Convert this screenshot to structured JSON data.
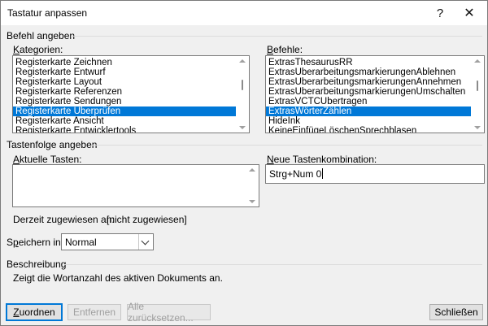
{
  "window": {
    "title": "Tastatur anpassen",
    "help_glyph": "?",
    "close_glyph": "✕"
  },
  "befehl": {
    "section_label": "Befehl angeben",
    "kategorien": {
      "label": "Kategorien:",
      "items": [
        {
          "label": "Registerkarte Zeichnen",
          "selected": false
        },
        {
          "label": "Registerkarte Entwurf",
          "selected": false
        },
        {
          "label": "Registerkarte Layout",
          "selected": false
        },
        {
          "label": "Registerkarte Referenzen",
          "selected": false
        },
        {
          "label": "Registerkarte Sendungen",
          "selected": false
        },
        {
          "label": "Registerkarte Überprüfen",
          "selected": true
        },
        {
          "label": "Registerkarte Ansicht",
          "selected": false
        },
        {
          "label": "Registerkarte Entwicklertools",
          "selected": false
        }
      ]
    },
    "befehle": {
      "label": "Befehle:",
      "items": [
        {
          "label": "ExtrasThesaurusRR",
          "selected": false
        },
        {
          "label": "ExtrasÜberarbeitungsmarkierungenAblehnen",
          "selected": false
        },
        {
          "label": "ExtrasÜberarbeitungsmarkierungenAnnehmen",
          "selected": false
        },
        {
          "label": "ExtrasÜberarbeitungsmarkierungenUmschalten",
          "selected": false
        },
        {
          "label": "ExtrasVCTCÜbertragen",
          "selected": false
        },
        {
          "label": "ExtrasWörterZählen",
          "selected": true
        },
        {
          "label": "HideInk",
          "selected": false
        },
        {
          "label": "KeineEinfügeLöschenSprechblasen",
          "selected": false
        }
      ]
    }
  },
  "tastenfolge": {
    "section_label": "Tastenfolge angeben",
    "aktuelle_label": "Aktuelle Tasten:",
    "neue_label": "Neue Tastenkombination:",
    "neue_value": "Strg+Num 0",
    "zugewiesen_label": "Derzeit zugewiesen an:",
    "zugewiesen_value": "[nicht zugewiesen]"
  },
  "speichern": {
    "label": "Speichern in:",
    "value": "Normal"
  },
  "beschreibung": {
    "section_label": "Beschreibung",
    "text": "Zeigt die Wortanzahl des aktiven Dokuments an."
  },
  "buttons": {
    "zuordnen": "Zuordnen",
    "entfernen": "Entfernen",
    "alle": "Alle zurücksetzen...",
    "schliessen": "Schließen"
  },
  "colors": {
    "selection": "#0078d7",
    "dialog_bg": "#f0f0f0",
    "default_button_border": "#0078d7"
  }
}
